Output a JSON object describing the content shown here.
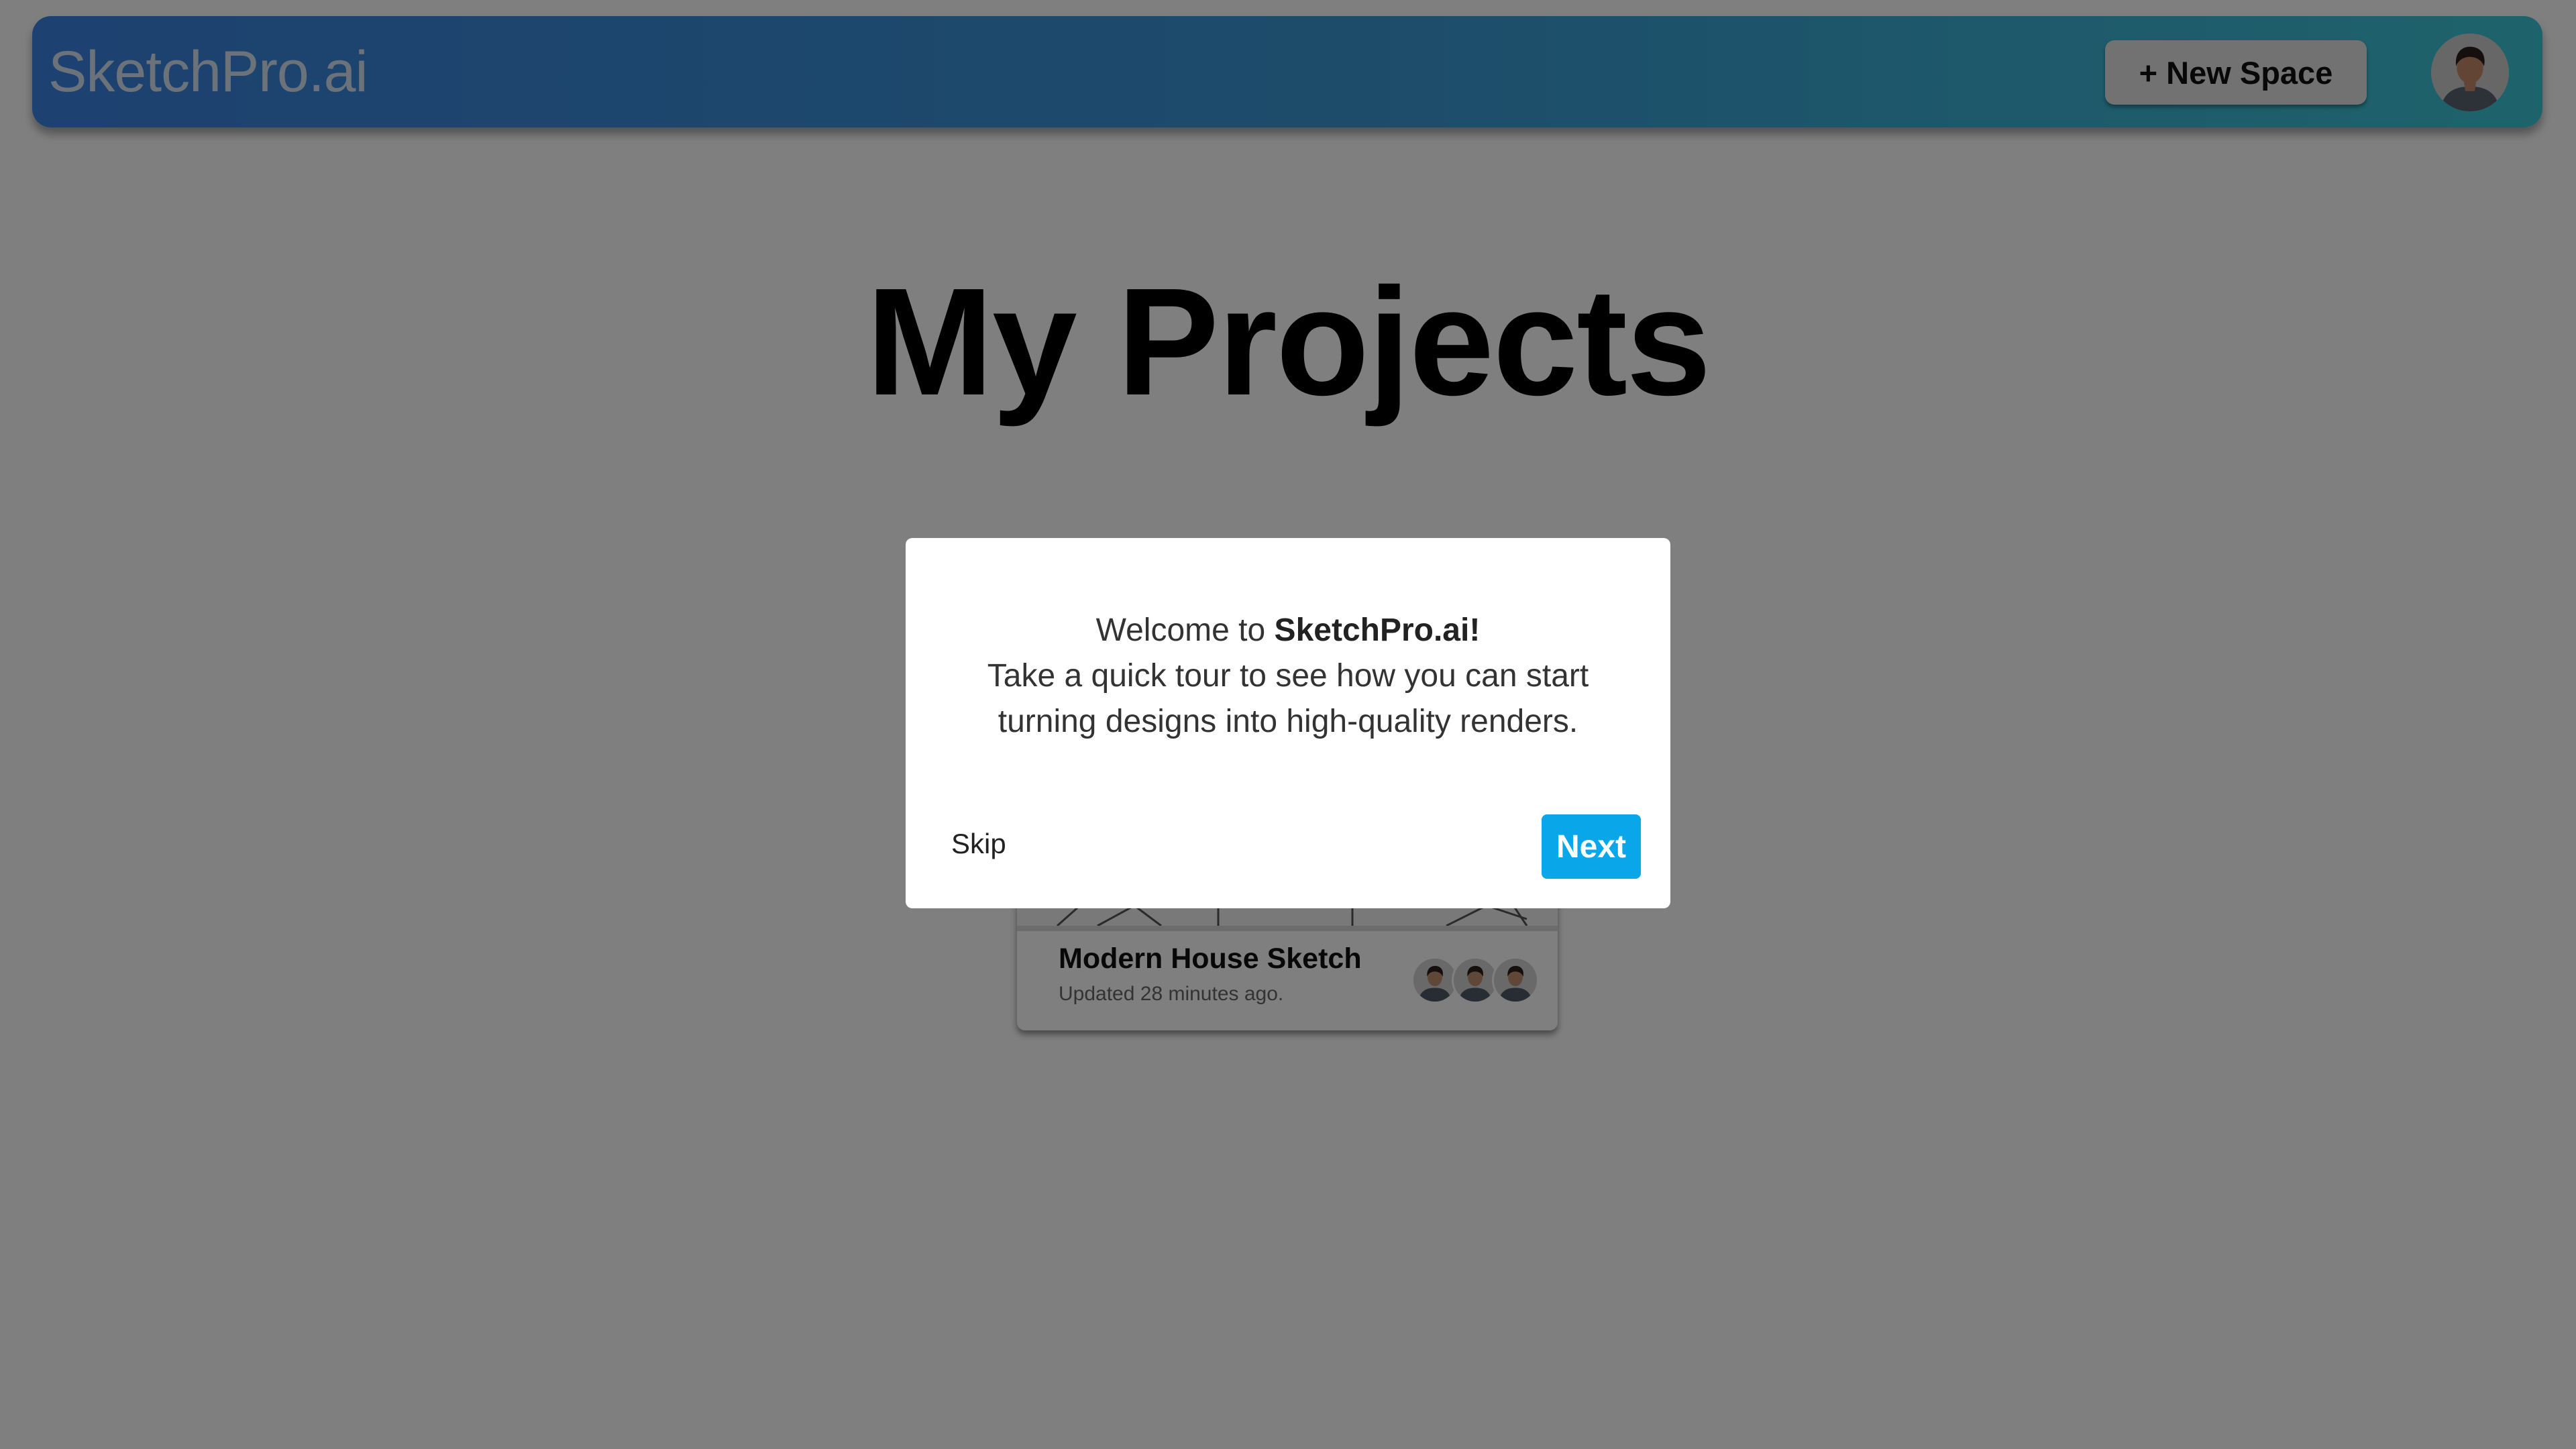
{
  "header": {
    "brand": "SketchPro.ai",
    "new_space_label": "+ New Space",
    "avatar_icon": "user-avatar-icon"
  },
  "main": {
    "title": "My Projects",
    "projects": [
      {
        "title": "Modern House Sketch",
        "updated": "Updated 28 minutes ago.",
        "collaborator_count": 3
      }
    ]
  },
  "modal": {
    "line1_prefix": "Welcome to ",
    "line1_brand": "SketchPro.ai!",
    "line2": "Take a quick tour to see how you can start",
    "line3": "turning designs into high-quality renders.",
    "skip_label": "Skip",
    "next_label": "Next"
  },
  "colors": {
    "header_gradient_start": "#3a82e0",
    "header_gradient_end": "#3cc7d6",
    "primary_button": "#0aa6ea",
    "overlay": "rgba(0,0,0,0.5)"
  }
}
